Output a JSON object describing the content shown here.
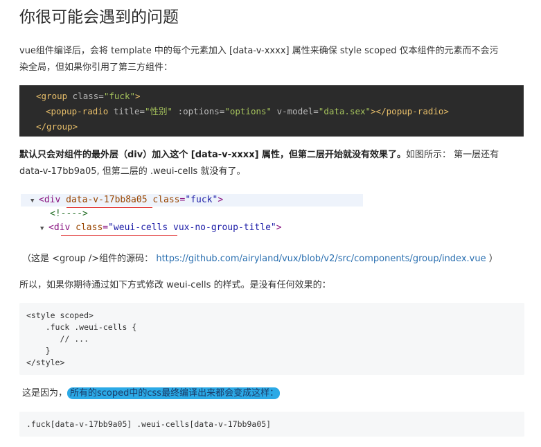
{
  "heading": "你很可能会遇到的问题",
  "intro": {
    "line1": "vue组件编译后，会将 template 中的每个元素加入 [data-v-xxxx] 属性来确保 style scoped 仅本组件的元素而不会污",
    "line2": "染全局，但如果你引用了第三方组件："
  },
  "code1": {
    "line1": {
      "open": "<group",
      "attr": " class=",
      "val": "\"fuck\"",
      "close": ">"
    },
    "line2": {
      "open": "<popup-radio",
      "attr1": " title=",
      "val1": "\"性别\"",
      "attr2": " :options=",
      "val2": "\"options\"",
      "attr3": " v-model=",
      "val3": "\"data.sex\"",
      "close": "></popup-radio>"
    },
    "line3": "</group>"
  },
  "explain": {
    "bold": "默认只会对组件的最外层（div）加入这个 [data-v-xxxx] 属性，但第二层开始就没有效果了。",
    "rest": "如图所示： 第一层还有",
    "line2": "data-v-17bb9a05, 但第二层的 .weui-cells 就没有了。"
  },
  "devtools": {
    "row1": {
      "tag_open": "<div",
      "attr1": "data-v-17bb8a05",
      "attr2": "class",
      "val2": "\"fuck\"",
      "tag_close": ">"
    },
    "row2": "<!---->",
    "row3": {
      "tag_open": "<div",
      "attr": "class",
      "val": "\"weui-cells",
      "val_rest": " vux-no-group-title\"",
      "tag_close": ">"
    }
  },
  "source_note": {
    "prefix": "（这是 <group />组件的源码：",
    "link": "https://github.com/airyland/vux/blob/v2/src/components/group/index.vue",
    "suffix": "）"
  },
  "so_line": "所以，如果你期待通过如下方式修改 weui-cells 的样式。是没有任何效果的：",
  "code2": {
    "line1": "<style scoped>",
    "line2": "    .fuck .weui-cells {",
    "line3": "       // ...",
    "line4": "    }",
    "line5": "</style>"
  },
  "because": {
    "prefix": "这是因为，",
    "highlighted": "所有的scoped中的css最终编译出来都会变成这样："
  },
  "code3": ".fuck[data-v-17bb9a05] .weui-cells[data-v-17bb9a05]",
  "colors": {
    "highlight": "#2ba9e6",
    "link": "#2a6fb0",
    "dark_code_bg": "#2b2b2b"
  }
}
